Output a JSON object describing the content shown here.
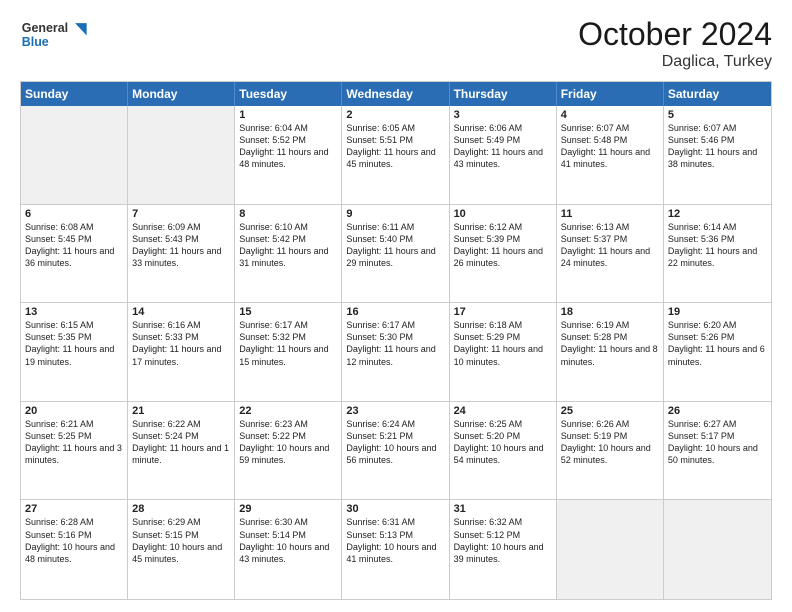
{
  "header": {
    "logo_general": "General",
    "logo_blue": "Blue",
    "month_title": "October 2024",
    "subtitle": "Daglica, Turkey"
  },
  "weekdays": [
    "Sunday",
    "Monday",
    "Tuesday",
    "Wednesday",
    "Thursday",
    "Friday",
    "Saturday"
  ],
  "weeks": [
    [
      {
        "day": "",
        "sunrise": "",
        "sunset": "",
        "daylight": "",
        "empty": true
      },
      {
        "day": "",
        "sunrise": "",
        "sunset": "",
        "daylight": "",
        "empty": true
      },
      {
        "day": "1",
        "sunrise": "Sunrise: 6:04 AM",
        "sunset": "Sunset: 5:52 PM",
        "daylight": "Daylight: 11 hours and 48 minutes."
      },
      {
        "day": "2",
        "sunrise": "Sunrise: 6:05 AM",
        "sunset": "Sunset: 5:51 PM",
        "daylight": "Daylight: 11 hours and 45 minutes."
      },
      {
        "day": "3",
        "sunrise": "Sunrise: 6:06 AM",
        "sunset": "Sunset: 5:49 PM",
        "daylight": "Daylight: 11 hours and 43 minutes."
      },
      {
        "day": "4",
        "sunrise": "Sunrise: 6:07 AM",
        "sunset": "Sunset: 5:48 PM",
        "daylight": "Daylight: 11 hours and 41 minutes."
      },
      {
        "day": "5",
        "sunrise": "Sunrise: 6:07 AM",
        "sunset": "Sunset: 5:46 PM",
        "daylight": "Daylight: 11 hours and 38 minutes."
      }
    ],
    [
      {
        "day": "6",
        "sunrise": "Sunrise: 6:08 AM",
        "sunset": "Sunset: 5:45 PM",
        "daylight": "Daylight: 11 hours and 36 minutes."
      },
      {
        "day": "7",
        "sunrise": "Sunrise: 6:09 AM",
        "sunset": "Sunset: 5:43 PM",
        "daylight": "Daylight: 11 hours and 33 minutes."
      },
      {
        "day": "8",
        "sunrise": "Sunrise: 6:10 AM",
        "sunset": "Sunset: 5:42 PM",
        "daylight": "Daylight: 11 hours and 31 minutes."
      },
      {
        "day": "9",
        "sunrise": "Sunrise: 6:11 AM",
        "sunset": "Sunset: 5:40 PM",
        "daylight": "Daylight: 11 hours and 29 minutes."
      },
      {
        "day": "10",
        "sunrise": "Sunrise: 6:12 AM",
        "sunset": "Sunset: 5:39 PM",
        "daylight": "Daylight: 11 hours and 26 minutes."
      },
      {
        "day": "11",
        "sunrise": "Sunrise: 6:13 AM",
        "sunset": "Sunset: 5:37 PM",
        "daylight": "Daylight: 11 hours and 24 minutes."
      },
      {
        "day": "12",
        "sunrise": "Sunrise: 6:14 AM",
        "sunset": "Sunset: 5:36 PM",
        "daylight": "Daylight: 11 hours and 22 minutes."
      }
    ],
    [
      {
        "day": "13",
        "sunrise": "Sunrise: 6:15 AM",
        "sunset": "Sunset: 5:35 PM",
        "daylight": "Daylight: 11 hours and 19 minutes."
      },
      {
        "day": "14",
        "sunrise": "Sunrise: 6:16 AM",
        "sunset": "Sunset: 5:33 PM",
        "daylight": "Daylight: 11 hours and 17 minutes."
      },
      {
        "day": "15",
        "sunrise": "Sunrise: 6:17 AM",
        "sunset": "Sunset: 5:32 PM",
        "daylight": "Daylight: 11 hours and 15 minutes."
      },
      {
        "day": "16",
        "sunrise": "Sunrise: 6:17 AM",
        "sunset": "Sunset: 5:30 PM",
        "daylight": "Daylight: 11 hours and 12 minutes."
      },
      {
        "day": "17",
        "sunrise": "Sunrise: 6:18 AM",
        "sunset": "Sunset: 5:29 PM",
        "daylight": "Daylight: 11 hours and 10 minutes."
      },
      {
        "day": "18",
        "sunrise": "Sunrise: 6:19 AM",
        "sunset": "Sunset: 5:28 PM",
        "daylight": "Daylight: 11 hours and 8 minutes."
      },
      {
        "day": "19",
        "sunrise": "Sunrise: 6:20 AM",
        "sunset": "Sunset: 5:26 PM",
        "daylight": "Daylight: 11 hours and 6 minutes."
      }
    ],
    [
      {
        "day": "20",
        "sunrise": "Sunrise: 6:21 AM",
        "sunset": "Sunset: 5:25 PM",
        "daylight": "Daylight: 11 hours and 3 minutes."
      },
      {
        "day": "21",
        "sunrise": "Sunrise: 6:22 AM",
        "sunset": "Sunset: 5:24 PM",
        "daylight": "Daylight: 11 hours and 1 minute."
      },
      {
        "day": "22",
        "sunrise": "Sunrise: 6:23 AM",
        "sunset": "Sunset: 5:22 PM",
        "daylight": "Daylight: 10 hours and 59 minutes."
      },
      {
        "day": "23",
        "sunrise": "Sunrise: 6:24 AM",
        "sunset": "Sunset: 5:21 PM",
        "daylight": "Daylight: 10 hours and 56 minutes."
      },
      {
        "day": "24",
        "sunrise": "Sunrise: 6:25 AM",
        "sunset": "Sunset: 5:20 PM",
        "daylight": "Daylight: 10 hours and 54 minutes."
      },
      {
        "day": "25",
        "sunrise": "Sunrise: 6:26 AM",
        "sunset": "Sunset: 5:19 PM",
        "daylight": "Daylight: 10 hours and 52 minutes."
      },
      {
        "day": "26",
        "sunrise": "Sunrise: 6:27 AM",
        "sunset": "Sunset: 5:17 PM",
        "daylight": "Daylight: 10 hours and 50 minutes."
      }
    ],
    [
      {
        "day": "27",
        "sunrise": "Sunrise: 6:28 AM",
        "sunset": "Sunset: 5:16 PM",
        "daylight": "Daylight: 10 hours and 48 minutes."
      },
      {
        "day": "28",
        "sunrise": "Sunrise: 6:29 AM",
        "sunset": "Sunset: 5:15 PM",
        "daylight": "Daylight: 10 hours and 45 minutes."
      },
      {
        "day": "29",
        "sunrise": "Sunrise: 6:30 AM",
        "sunset": "Sunset: 5:14 PM",
        "daylight": "Daylight: 10 hours and 43 minutes."
      },
      {
        "day": "30",
        "sunrise": "Sunrise: 6:31 AM",
        "sunset": "Sunset: 5:13 PM",
        "daylight": "Daylight: 10 hours and 41 minutes."
      },
      {
        "day": "31",
        "sunrise": "Sunrise: 6:32 AM",
        "sunset": "Sunset: 5:12 PM",
        "daylight": "Daylight: 10 hours and 39 minutes."
      },
      {
        "day": "",
        "sunrise": "",
        "sunset": "",
        "daylight": "",
        "empty": true
      },
      {
        "day": "",
        "sunrise": "",
        "sunset": "",
        "daylight": "",
        "empty": true
      }
    ]
  ]
}
